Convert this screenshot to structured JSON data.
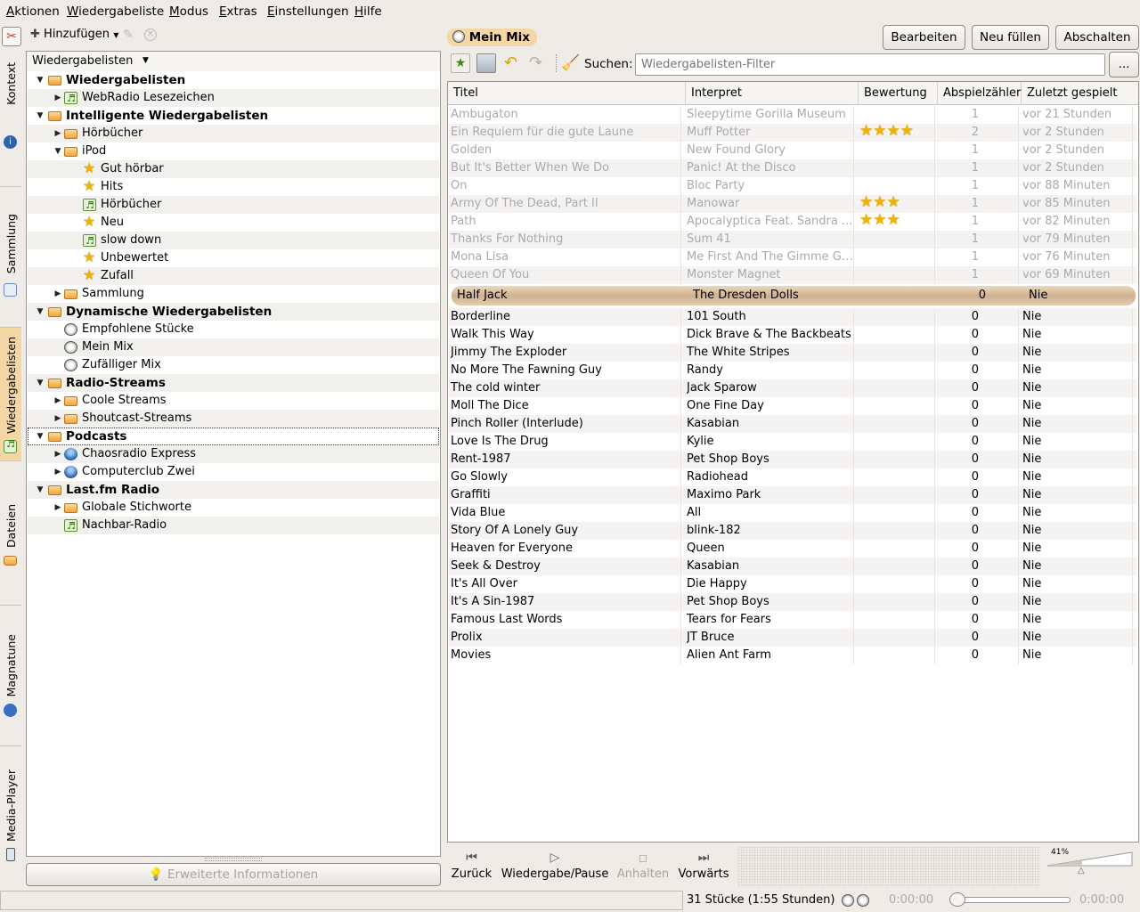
{
  "menu": [
    "Aktionen",
    "Wiedergabeliste",
    "Modus",
    "Extras",
    "Einstellungen",
    "Hilfe"
  ],
  "sidebar_tabs": [
    "Kontext",
    "Sammlung",
    "Wiedergabelisten",
    "Dateien",
    "Magnatune",
    "Media-Player"
  ],
  "left_toolbar": {
    "add_label": "Hinzufügen"
  },
  "tree_header": "Wiedergabelisten",
  "tree": [
    {
      "label": "Wiedergabelisten",
      "level": 0,
      "expander": "open",
      "icon": "folder-icon",
      "bold": true
    },
    {
      "label": "WebRadio Lesezeichen",
      "level": 1,
      "expander": "closed",
      "icon": "playlist-icon"
    },
    {
      "label": "Intelligente Wiedergabelisten",
      "level": 0,
      "expander": "open",
      "icon": "folder-icon",
      "bold": true
    },
    {
      "label": "Hörbücher",
      "level": 1,
      "expander": "closed",
      "icon": "folder-icon"
    },
    {
      "label": "iPod",
      "level": 1,
      "expander": "open",
      "icon": "folder-icon"
    },
    {
      "label": "Gut hörbar",
      "level": 2,
      "expander": "none",
      "icon": "star-icon"
    },
    {
      "label": "Hits",
      "level": 2,
      "expander": "none",
      "icon": "star-icon"
    },
    {
      "label": "Hörbücher",
      "level": 2,
      "expander": "none",
      "icon": "playlist-icon"
    },
    {
      "label": "Neu",
      "level": 2,
      "expander": "none",
      "icon": "star-icon"
    },
    {
      "label": "slow down",
      "level": 2,
      "expander": "none",
      "icon": "playlist-icon"
    },
    {
      "label": "Unbewertet",
      "level": 2,
      "expander": "none",
      "icon": "star-icon"
    },
    {
      "label": "Zufall",
      "level": 2,
      "expander": "none",
      "icon": "star-icon"
    },
    {
      "label": "Sammlung",
      "level": 1,
      "expander": "closed",
      "icon": "folder-icon"
    },
    {
      "label": "Dynamische Wiedergabelisten",
      "level": 0,
      "expander": "open",
      "icon": "folder-icon",
      "bold": true
    },
    {
      "label": "Empfohlene Stücke",
      "level": 1,
      "expander": "none",
      "icon": "dice-icon"
    },
    {
      "label": "Mein Mix",
      "level": 1,
      "expander": "none",
      "icon": "dice-icon"
    },
    {
      "label": "Zufälliger Mix",
      "level": 1,
      "expander": "none",
      "icon": "dice-icon"
    },
    {
      "label": "Radio-Streams",
      "level": 0,
      "expander": "open",
      "icon": "folder-icon",
      "bold": true
    },
    {
      "label": "Coole Streams",
      "level": 1,
      "expander": "closed",
      "icon": "folder-icon"
    },
    {
      "label": "Shoutcast-Streams",
      "level": 1,
      "expander": "closed",
      "icon": "folder-icon"
    },
    {
      "label": "Podcasts",
      "level": 0,
      "expander": "open",
      "icon": "folder-icon",
      "bold": true,
      "focused": true
    },
    {
      "label": "Chaosradio Express",
      "level": 1,
      "expander": "closed",
      "icon": "podcast-icon"
    },
    {
      "label": "Computerclub Zwei",
      "level": 1,
      "expander": "closed",
      "icon": "podcast-icon"
    },
    {
      "label": "Last.fm Radio",
      "level": 0,
      "expander": "open",
      "icon": "folder-icon",
      "bold": true
    },
    {
      "label": "Globale Stichworte",
      "level": 1,
      "expander": "closed",
      "icon": "folder-icon"
    },
    {
      "label": "Nachbar-Radio",
      "level": 1,
      "expander": "none",
      "icon": "playlist-icon"
    }
  ],
  "more_info_label": "Erweiterte Informationen",
  "mix_title": "Mein Mix",
  "buttons": {
    "edit": "Bearbeiten",
    "refill": "Neu füllen",
    "disable": "Abschalten"
  },
  "search": {
    "label": "Suchen:",
    "placeholder": "Wiedergabelisten-Filter",
    "more": "..."
  },
  "columns": [
    "Titel",
    "Interpret",
    "Bewertung",
    "Abspielzähler",
    "Zuletzt gespielt"
  ],
  "tracks": [
    {
      "title": "Ambugaton",
      "artist": "Sleepytime Gorilla Museum",
      "rating": 0,
      "count": "1",
      "last": "vor 21 Stunden",
      "played": true
    },
    {
      "title": "Ein Requiem für die gute Laune",
      "artist": "Muff Potter",
      "rating": 4,
      "count": "2",
      "last": "vor 2 Stunden",
      "played": true
    },
    {
      "title": "Golden",
      "artist": "New Found Glory",
      "rating": 0,
      "count": "1",
      "last": "vor 2 Stunden",
      "played": true
    },
    {
      "title": "But It's Better When We Do",
      "artist": "Panic! At the Disco",
      "rating": 0,
      "count": "1",
      "last": "vor 2 Stunden",
      "played": true
    },
    {
      "title": "On",
      "artist": "Bloc Party",
      "rating": 0,
      "count": "1",
      "last": "vor 88 Minuten",
      "played": true
    },
    {
      "title": "Army Of The Dead, Part II",
      "artist": "Manowar",
      "rating": 3,
      "count": "1",
      "last": "vor 85 Minuten",
      "played": true
    },
    {
      "title": "Path",
      "artist": "Apocalyptica Feat. Sandra ...",
      "rating": 3,
      "count": "1",
      "last": "vor 82 Minuten",
      "played": true
    },
    {
      "title": "Thanks For Nothing",
      "artist": "Sum 41",
      "rating": 0,
      "count": "1",
      "last": "vor 79 Minuten",
      "played": true
    },
    {
      "title": "Mona Lisa",
      "artist": "Me First And The Gimme Gi...",
      "rating": 0,
      "count": "1",
      "last": "vor 76 Minuten",
      "played": true
    },
    {
      "title": "Queen Of You",
      "artist": "Monster Magnet",
      "rating": 0,
      "count": "1",
      "last": "vor 69 Minuten",
      "played": true
    },
    {
      "title": "Half Jack",
      "artist": "The Dresden Dolls",
      "rating": 0,
      "count": "0",
      "last": "Nie",
      "current": true
    },
    {
      "title": "Borderline",
      "artist": "101 South",
      "rating": 0,
      "count": "0",
      "last": "Nie"
    },
    {
      "title": "Walk This Way",
      "artist": "Dick Brave & The Backbeats",
      "rating": 0,
      "count": "0",
      "last": "Nie"
    },
    {
      "title": "Jimmy The Exploder",
      "artist": "The White Stripes",
      "rating": 0,
      "count": "0",
      "last": "Nie"
    },
    {
      "title": "No More The Fawning Guy",
      "artist": "Randy",
      "rating": 0,
      "count": "0",
      "last": "Nie"
    },
    {
      "title": "The cold winter",
      "artist": "Jack Sparow",
      "rating": 0,
      "count": "0",
      "last": "Nie"
    },
    {
      "title": "Moll The Dice",
      "artist": "One Fine Day",
      "rating": 0,
      "count": "0",
      "last": "Nie"
    },
    {
      "title": "Pinch Roller (Interlude)",
      "artist": "Kasabian",
      "rating": 0,
      "count": "0",
      "last": "Nie"
    },
    {
      "title": "Love Is The Drug",
      "artist": "Kylie",
      "rating": 0,
      "count": "0",
      "last": "Nie"
    },
    {
      "title": "Rent-1987",
      "artist": "Pet Shop Boys",
      "rating": 0,
      "count": "0",
      "last": "Nie"
    },
    {
      "title": "Go Slowly",
      "artist": "Radiohead",
      "rating": 0,
      "count": "0",
      "last": "Nie"
    },
    {
      "title": "Graffiti",
      "artist": "Maximo Park",
      "rating": 0,
      "count": "0",
      "last": "Nie"
    },
    {
      "title": "Vida Blue",
      "artist": "All",
      "rating": 0,
      "count": "0",
      "last": "Nie"
    },
    {
      "title": "Story Of A Lonely Guy",
      "artist": "blink-182",
      "rating": 0,
      "count": "0",
      "last": "Nie"
    },
    {
      "title": "Heaven for Everyone",
      "artist": "Queen",
      "rating": 0,
      "count": "0",
      "last": "Nie"
    },
    {
      "title": "Seek & Destroy",
      "artist": "Kasabian",
      "rating": 0,
      "count": "0",
      "last": "Nie"
    },
    {
      "title": "It's All Over",
      "artist": "Die Happy",
      "rating": 0,
      "count": "0",
      "last": "Nie"
    },
    {
      "title": "It's A Sin-1987",
      "artist": "Pet Shop Boys",
      "rating": 0,
      "count": "0",
      "last": "Nie"
    },
    {
      "title": "Famous Last Words",
      "artist": "Tears for Fears",
      "rating": 0,
      "count": "0",
      "last": "Nie"
    },
    {
      "title": "Prolix",
      "artist": "JT Bruce",
      "rating": 0,
      "count": "0",
      "last": "Nie"
    },
    {
      "title": "Movies",
      "artist": "Alien Ant Farm",
      "rating": 0,
      "count": "0",
      "last": "Nie"
    }
  ],
  "player": {
    "back": "Zurück",
    "play": "Wiedergabe/Pause",
    "stop": "Anhalten",
    "forward": "Vorwärts",
    "volume": "41%",
    "volume_level": 0.41
  },
  "status": {
    "tracks": "31 Stücke (1:55 Stunden)",
    "elapsed": "0:00:00",
    "remaining": "0:00:00"
  },
  "colors": {
    "accent": "#f5d7a6",
    "star": "#f0b400",
    "played_text": "#aaaaaa"
  }
}
